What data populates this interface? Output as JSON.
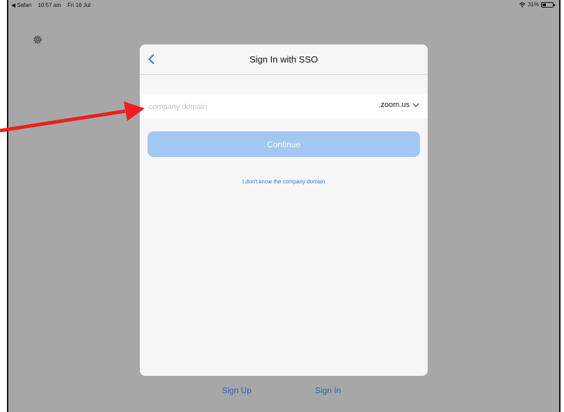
{
  "status_bar": {
    "back_app": "◀ Safari",
    "time": "10:57 am",
    "date": "Fri 16 Jul",
    "battery": "31%"
  },
  "modal": {
    "title": "Sign In with SSO",
    "domain_placeholder": "company domain",
    "domain_value": "",
    "domain_suffix": ".zoom.us",
    "continue_label": "Continue",
    "unknown_domain_link": "I don't know the company domain"
  },
  "bottom": {
    "sign_up": "Sign Up",
    "sign_in": "Sign In"
  },
  "colors": {
    "accent": "#2f7de1",
    "continue_disabled": "#a2c7f3",
    "annotation_arrow": "#ef1d1d"
  }
}
